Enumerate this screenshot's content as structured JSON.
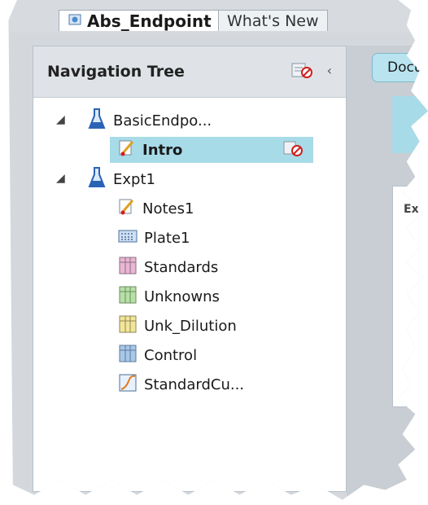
{
  "tabs": [
    {
      "label": "Abs_Endpoint",
      "active": true
    },
    {
      "label": "What's New",
      "active": false
    }
  ],
  "nav": {
    "title": "Navigation Tree",
    "items": [
      {
        "label": "BasicEndpo...",
        "icon": "flask-icon",
        "expanded": true,
        "level": 0
      },
      {
        "label": "Intro",
        "icon": "note-icon",
        "selected": true,
        "level": 1
      },
      {
        "label": "Expt1",
        "icon": "flask-icon",
        "expanded": true,
        "level": 0
      },
      {
        "label": "Notes1",
        "icon": "note-icon",
        "level": 1
      },
      {
        "label": "Plate1",
        "icon": "plate-icon",
        "level": 1
      },
      {
        "label": "Standards",
        "icon": "group-icon",
        "level": 1,
        "color": "#e9b6d3"
      },
      {
        "label": "Unknowns",
        "icon": "group-icon",
        "level": 1,
        "color": "#b6e0a6"
      },
      {
        "label": "Unk_Dilution",
        "icon": "group-icon",
        "level": 1,
        "color": "#f2e59a"
      },
      {
        "label": "Control",
        "icon": "group-icon",
        "level": 1,
        "color": "#a8c8ea"
      },
      {
        "label": "StandardCu...",
        "icon": "graph-icon",
        "level": 1
      }
    ]
  },
  "right": {
    "docs_label": "Docu",
    "card_label": "Ex"
  },
  "colors": {
    "selection": "#a8dbe8",
    "flask": "#2a63b6"
  }
}
